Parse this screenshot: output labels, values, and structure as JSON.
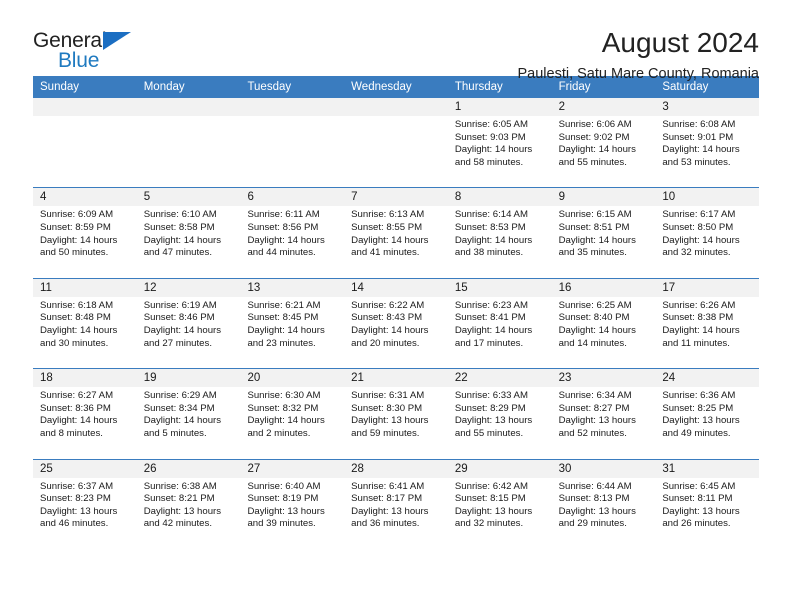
{
  "brand": {
    "word1": "General",
    "word2": "Blue",
    "accent_color": "#1b6ec2",
    "triangle_icon": "triangle-icon"
  },
  "header": {
    "title": "August 2024",
    "subtitle": "Paulesti, Satu Mare County, Romania"
  },
  "calendar": {
    "header_bg": "#3a7cbf",
    "daynum_bg": "#f2f2f2",
    "weekdays": [
      "Sunday",
      "Monday",
      "Tuesday",
      "Wednesday",
      "Thursday",
      "Friday",
      "Saturday"
    ],
    "weeks": [
      [
        {
          "day": "",
          "lines": []
        },
        {
          "day": "",
          "lines": []
        },
        {
          "day": "",
          "lines": []
        },
        {
          "day": "",
          "lines": []
        },
        {
          "day": "1",
          "lines": [
            "Sunrise: 6:05 AM",
            "Sunset: 9:03 PM",
            "Daylight: 14 hours",
            "and 58 minutes."
          ]
        },
        {
          "day": "2",
          "lines": [
            "Sunrise: 6:06 AM",
            "Sunset: 9:02 PM",
            "Daylight: 14 hours",
            "and 55 minutes."
          ]
        },
        {
          "day": "3",
          "lines": [
            "Sunrise: 6:08 AM",
            "Sunset: 9:01 PM",
            "Daylight: 14 hours",
            "and 53 minutes."
          ]
        }
      ],
      [
        {
          "day": "4",
          "lines": [
            "Sunrise: 6:09 AM",
            "Sunset: 8:59 PM",
            "Daylight: 14 hours",
            "and 50 minutes."
          ]
        },
        {
          "day": "5",
          "lines": [
            "Sunrise: 6:10 AM",
            "Sunset: 8:58 PM",
            "Daylight: 14 hours",
            "and 47 minutes."
          ]
        },
        {
          "day": "6",
          "lines": [
            "Sunrise: 6:11 AM",
            "Sunset: 8:56 PM",
            "Daylight: 14 hours",
            "and 44 minutes."
          ]
        },
        {
          "day": "7",
          "lines": [
            "Sunrise: 6:13 AM",
            "Sunset: 8:55 PM",
            "Daylight: 14 hours",
            "and 41 minutes."
          ]
        },
        {
          "day": "8",
          "lines": [
            "Sunrise: 6:14 AM",
            "Sunset: 8:53 PM",
            "Daylight: 14 hours",
            "and 38 minutes."
          ]
        },
        {
          "day": "9",
          "lines": [
            "Sunrise: 6:15 AM",
            "Sunset: 8:51 PM",
            "Daylight: 14 hours",
            "and 35 minutes."
          ]
        },
        {
          "day": "10",
          "lines": [
            "Sunrise: 6:17 AM",
            "Sunset: 8:50 PM",
            "Daylight: 14 hours",
            "and 32 minutes."
          ]
        }
      ],
      [
        {
          "day": "11",
          "lines": [
            "Sunrise: 6:18 AM",
            "Sunset: 8:48 PM",
            "Daylight: 14 hours",
            "and 30 minutes."
          ]
        },
        {
          "day": "12",
          "lines": [
            "Sunrise: 6:19 AM",
            "Sunset: 8:46 PM",
            "Daylight: 14 hours",
            "and 27 minutes."
          ]
        },
        {
          "day": "13",
          "lines": [
            "Sunrise: 6:21 AM",
            "Sunset: 8:45 PM",
            "Daylight: 14 hours",
            "and 23 minutes."
          ]
        },
        {
          "day": "14",
          "lines": [
            "Sunrise: 6:22 AM",
            "Sunset: 8:43 PM",
            "Daylight: 14 hours",
            "and 20 minutes."
          ]
        },
        {
          "day": "15",
          "lines": [
            "Sunrise: 6:23 AM",
            "Sunset: 8:41 PM",
            "Daylight: 14 hours",
            "and 17 minutes."
          ]
        },
        {
          "day": "16",
          "lines": [
            "Sunrise: 6:25 AM",
            "Sunset: 8:40 PM",
            "Daylight: 14 hours",
            "and 14 minutes."
          ]
        },
        {
          "day": "17",
          "lines": [
            "Sunrise: 6:26 AM",
            "Sunset: 8:38 PM",
            "Daylight: 14 hours",
            "and 11 minutes."
          ]
        }
      ],
      [
        {
          "day": "18",
          "lines": [
            "Sunrise: 6:27 AM",
            "Sunset: 8:36 PM",
            "Daylight: 14 hours",
            "and 8 minutes."
          ]
        },
        {
          "day": "19",
          "lines": [
            "Sunrise: 6:29 AM",
            "Sunset: 8:34 PM",
            "Daylight: 14 hours",
            "and 5 minutes."
          ]
        },
        {
          "day": "20",
          "lines": [
            "Sunrise: 6:30 AM",
            "Sunset: 8:32 PM",
            "Daylight: 14 hours",
            "and 2 minutes."
          ]
        },
        {
          "day": "21",
          "lines": [
            "Sunrise: 6:31 AM",
            "Sunset: 8:30 PM",
            "Daylight: 13 hours",
            "and 59 minutes."
          ]
        },
        {
          "day": "22",
          "lines": [
            "Sunrise: 6:33 AM",
            "Sunset: 8:29 PM",
            "Daylight: 13 hours",
            "and 55 minutes."
          ]
        },
        {
          "day": "23",
          "lines": [
            "Sunrise: 6:34 AM",
            "Sunset: 8:27 PM",
            "Daylight: 13 hours",
            "and 52 minutes."
          ]
        },
        {
          "day": "24",
          "lines": [
            "Sunrise: 6:36 AM",
            "Sunset: 8:25 PM",
            "Daylight: 13 hours",
            "and 49 minutes."
          ]
        }
      ],
      [
        {
          "day": "25",
          "lines": [
            "Sunrise: 6:37 AM",
            "Sunset: 8:23 PM",
            "Daylight: 13 hours",
            "and 46 minutes."
          ]
        },
        {
          "day": "26",
          "lines": [
            "Sunrise: 6:38 AM",
            "Sunset: 8:21 PM",
            "Daylight: 13 hours",
            "and 42 minutes."
          ]
        },
        {
          "day": "27",
          "lines": [
            "Sunrise: 6:40 AM",
            "Sunset: 8:19 PM",
            "Daylight: 13 hours",
            "and 39 minutes."
          ]
        },
        {
          "day": "28",
          "lines": [
            "Sunrise: 6:41 AM",
            "Sunset: 8:17 PM",
            "Daylight: 13 hours",
            "and 36 minutes."
          ]
        },
        {
          "day": "29",
          "lines": [
            "Sunrise: 6:42 AM",
            "Sunset: 8:15 PM",
            "Daylight: 13 hours",
            "and 32 minutes."
          ]
        },
        {
          "day": "30",
          "lines": [
            "Sunrise: 6:44 AM",
            "Sunset: 8:13 PM",
            "Daylight: 13 hours",
            "and 29 minutes."
          ]
        },
        {
          "day": "31",
          "lines": [
            "Sunrise: 6:45 AM",
            "Sunset: 8:11 PM",
            "Daylight: 13 hours",
            "and 26 minutes."
          ]
        }
      ]
    ]
  }
}
